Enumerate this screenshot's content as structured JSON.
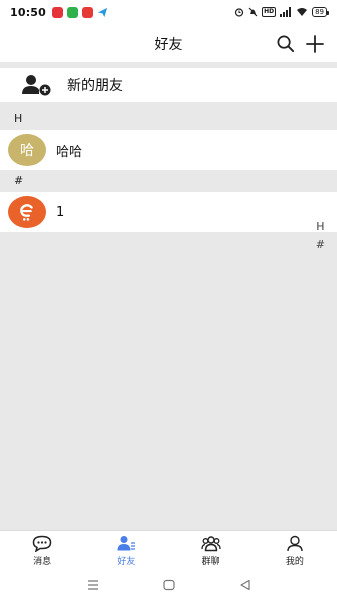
{
  "status_bar": {
    "time": "10:50",
    "battery": "89"
  },
  "header": {
    "title": "好友"
  },
  "new_friends": {
    "label": "新的朋友"
  },
  "sections": [
    {
      "letter": "H",
      "contacts": [
        {
          "name": "哈哈",
          "avatar_text": "哈",
          "avatar_color": "#c8b46a"
        }
      ]
    },
    {
      "letter": "#",
      "contacts": [
        {
          "name": "1",
          "avatar_color": "#e9622a"
        }
      ]
    }
  ],
  "index_bar": [
    "H",
    "#"
  ],
  "tabs": [
    {
      "label": "消息",
      "icon": "chat-bubble-icon"
    },
    {
      "label": "好友",
      "icon": "friends-icon",
      "active": true
    },
    {
      "label": "群聊",
      "icon": "group-icon"
    },
    {
      "label": "我的",
      "icon": "profile-icon"
    }
  ],
  "colors": {
    "accent": "#4a7ee8",
    "background": "#e8e8e8"
  }
}
